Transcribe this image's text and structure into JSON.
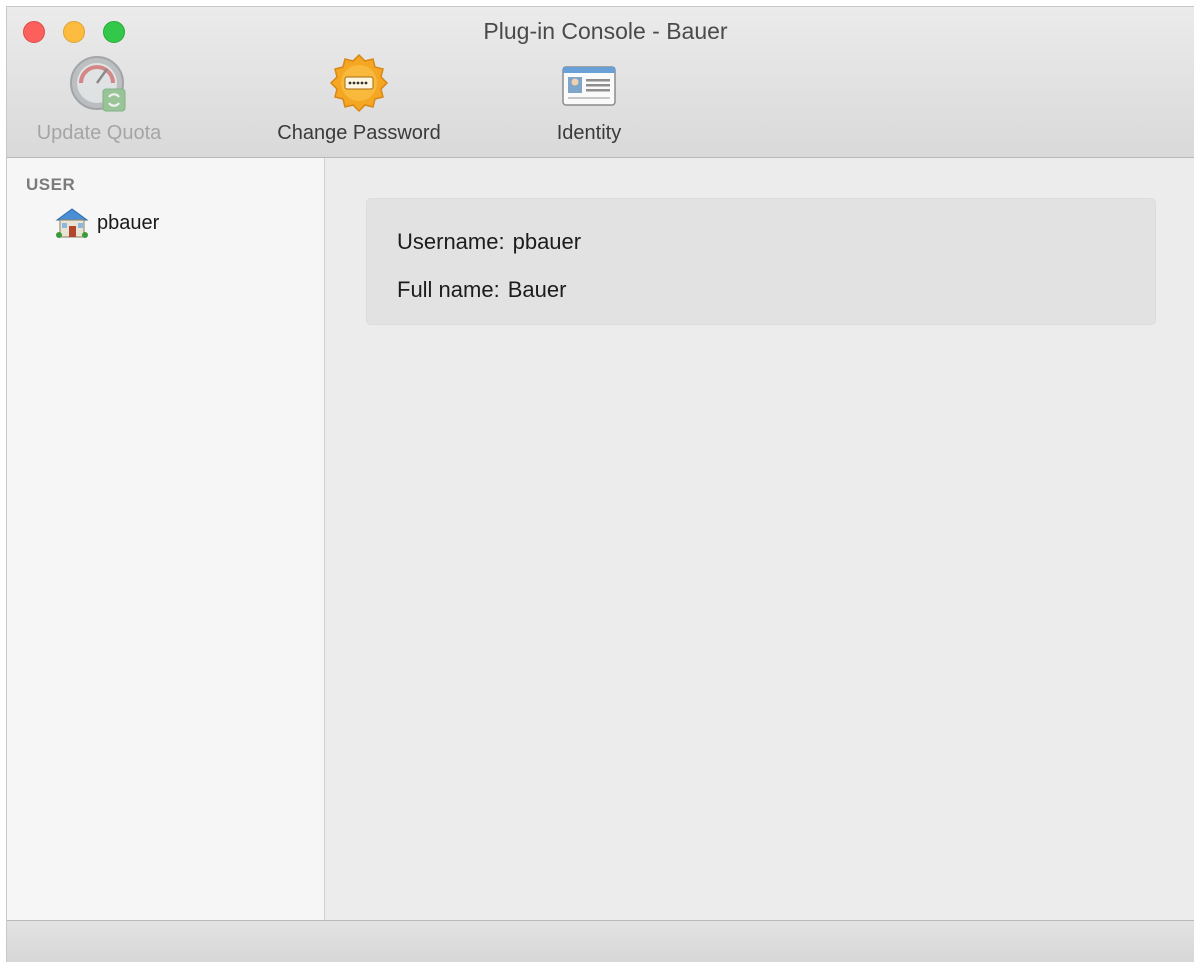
{
  "window": {
    "title": "Plug-in Console - Bauer"
  },
  "toolbar": {
    "items": [
      {
        "label": "Update Quota",
        "icon": "quota-gauge-icon",
        "enabled": false
      },
      {
        "label": "Change Password",
        "icon": "password-badge-icon",
        "enabled": true
      },
      {
        "label": "Identity",
        "icon": "id-card-icon",
        "enabled": true
      }
    ]
  },
  "sidebar": {
    "heading": "USER",
    "items": [
      {
        "label": "pbauer",
        "icon": "user-home-icon"
      }
    ]
  },
  "details": {
    "username_label": "Username:",
    "username_value": "pbauer",
    "fullname_label": "Full name:",
    "fullname_value": "Bauer"
  },
  "colors": {
    "close": "#fc605c",
    "minimize": "#fdbc40",
    "zoom": "#34c84a",
    "password_badge": "#f5a623"
  }
}
